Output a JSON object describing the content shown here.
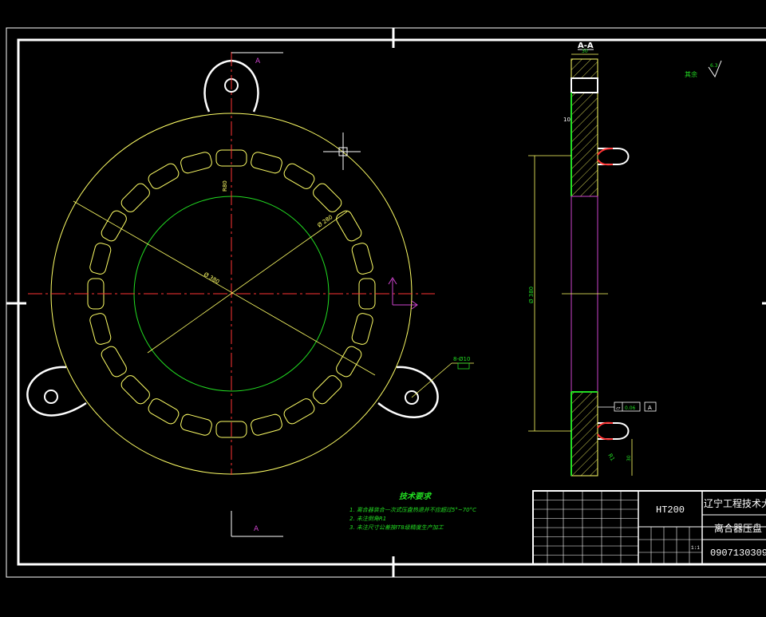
{
  "section_label": "A-A",
  "view_marker_top": "A",
  "view_marker_bottom": "A",
  "surface_finish_rest": "其余",
  "surface_finish_value": "6.3",
  "dim_hole_pattern": "Ø 380",
  "dim_inner_circle": "Ø 280",
  "dim_radial": "R80",
  "dim_hole_callout": "8-Ø10",
  "dim_total_dia": "Ø 380",
  "dim_width": "30",
  "dim_step": "10",
  "dim_fillet": "R1",
  "dim_bottom": "30",
  "tolerance_value": "0.06",
  "tolerance_datum": "A",
  "tech_requirements": {
    "title": "技术要求",
    "items": [
      "1. 离合器装合一次式压盘热退并不应超过5°~70°C",
      "2. 未注倒角R1",
      "3. 未注尺寸公差按IT8级精度生产加工"
    ]
  },
  "title_block": {
    "material": "HT200",
    "university": "辽宁工程技术大学",
    "part_name": "离合器压盘",
    "drawing_number": "0907130309",
    "scale": "1:1"
  },
  "colors": {
    "background": "#000000",
    "frame": "#ffffff",
    "outline": "#ffff66",
    "centerline": "#ff3333",
    "green": "#22dd22",
    "magenta": "#cc44cc",
    "hatch": "#ffff66"
  }
}
